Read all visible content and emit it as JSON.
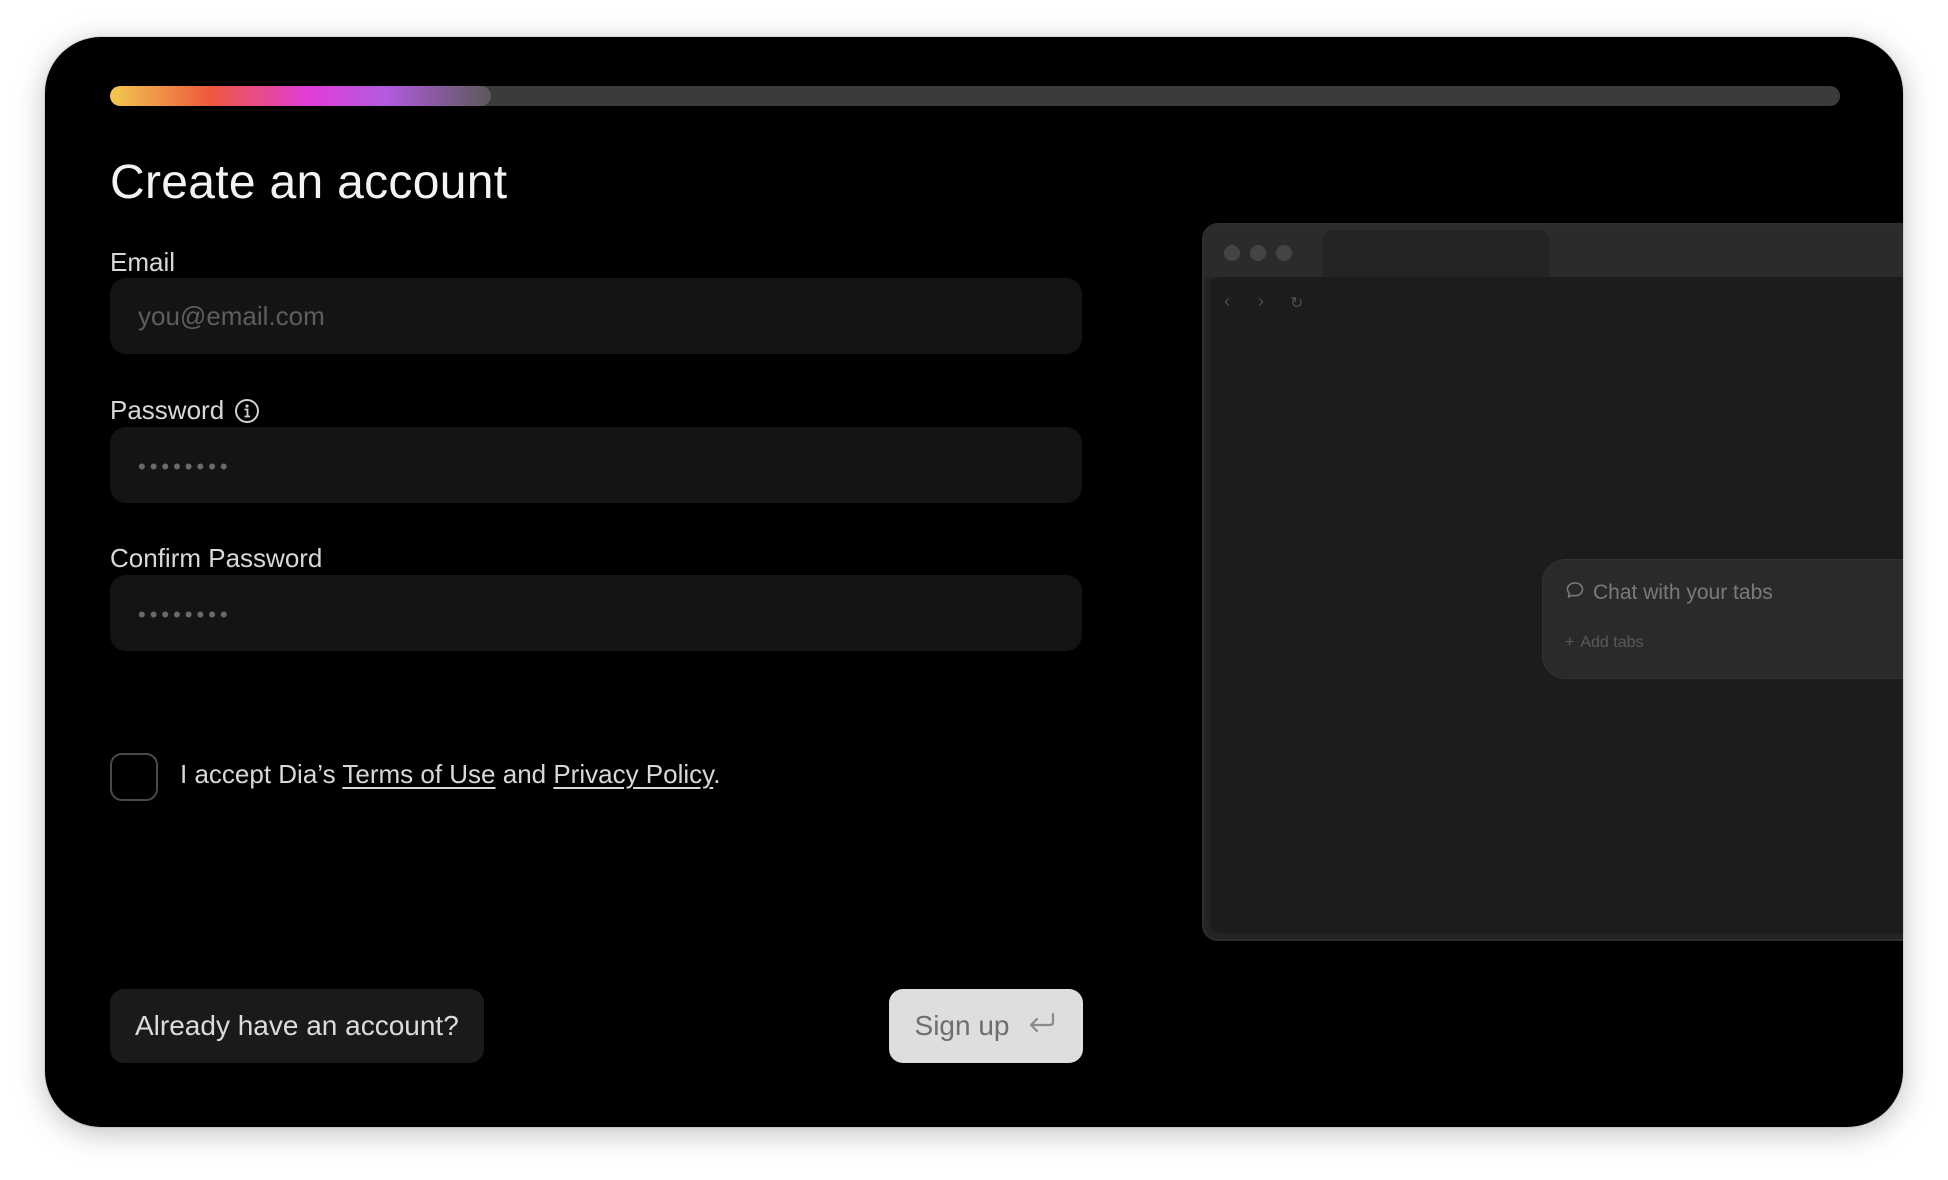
{
  "progress": {
    "value": 0.22
  },
  "page": {
    "title": "Create an account"
  },
  "form": {
    "email": {
      "label": "Email",
      "placeholder": "you@email.com",
      "value": ""
    },
    "password": {
      "label": "Password",
      "placeholder": "••••••••",
      "value": "",
      "info_icon": "info-circle-icon"
    },
    "confirm_password": {
      "label": "Confirm Password",
      "placeholder": "••••••••",
      "value": ""
    },
    "consent": {
      "checked": false,
      "prefix": "I accept Dia’s ",
      "terms_link": "Terms of Use",
      "middle": " and ",
      "privacy_link": "Privacy Policy",
      "suffix": "."
    }
  },
  "actions": {
    "login_label": "Already have an account?",
    "signup_label": "Sign up",
    "signup_icon": "return-arrow-icon"
  },
  "preview": {
    "chat_title": "Chat with your tabs",
    "add_tabs": "Add tabs"
  },
  "colors": {
    "background": "#000000",
    "input_background": "#141414",
    "primary_button": "#dedede",
    "progress_gradient": [
      "#f2c84f",
      "#ee5a3c",
      "#e23cd8",
      "#b45be0"
    ]
  }
}
